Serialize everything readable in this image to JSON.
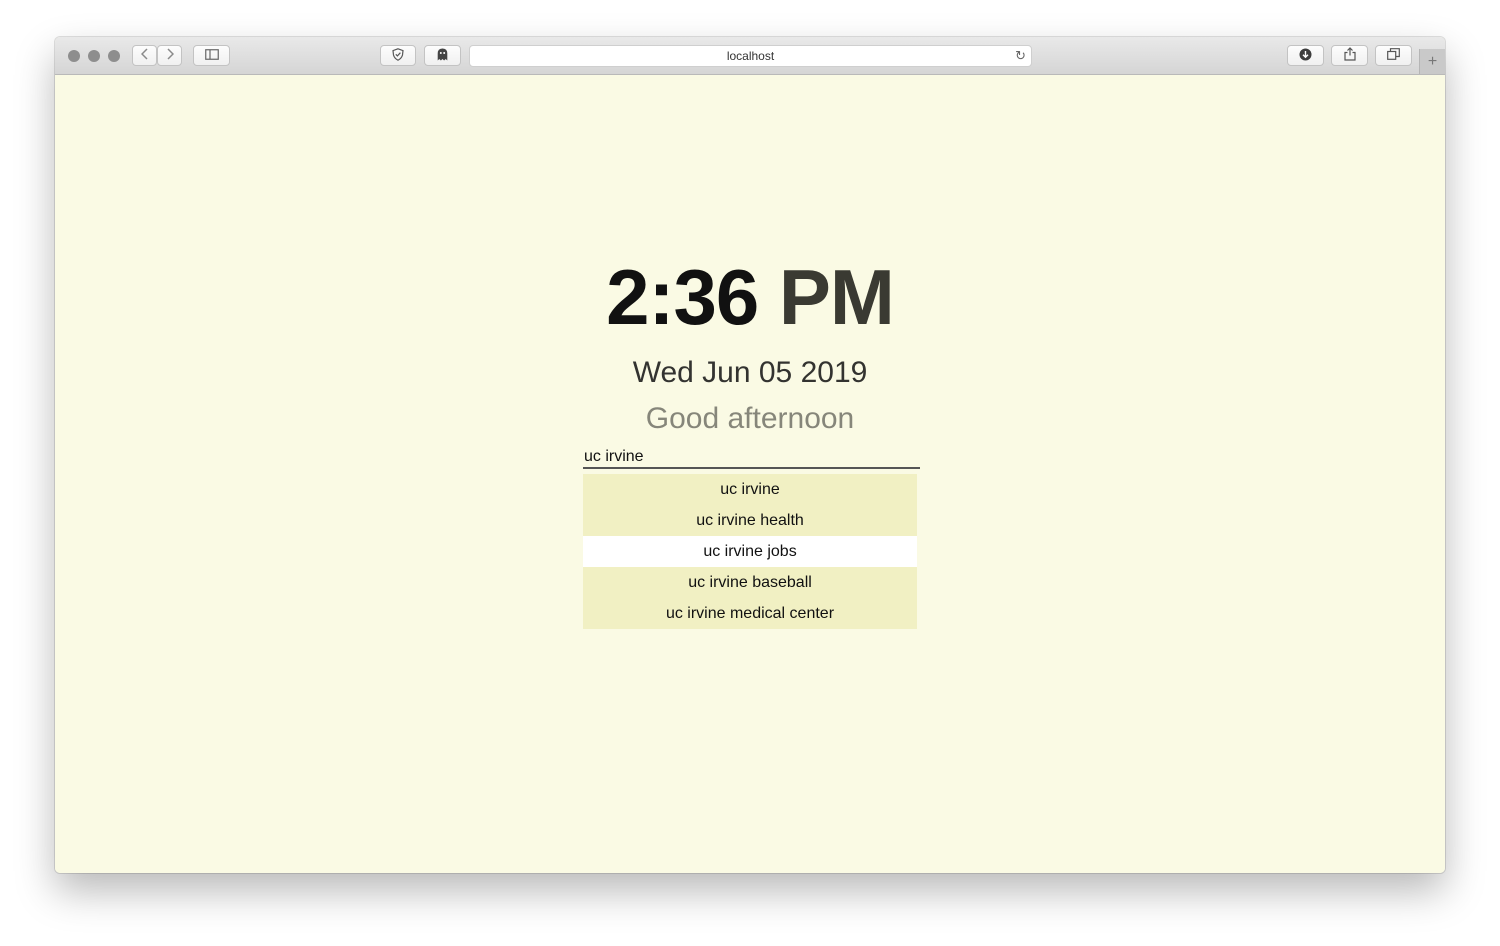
{
  "browser": {
    "url": "localhost",
    "new_tab_symbol": "+",
    "icons": [
      "back-icon",
      "forward-icon",
      "sidebar-icon",
      "shield-icon",
      "ghost-icon",
      "reload-icon",
      "download-icon",
      "share-icon",
      "tabs-icon"
    ]
  },
  "clock": {
    "time": "2:36",
    "ampm": "PM"
  },
  "date": "Wed Jun 05 2019",
  "greeting": "Good afternoon",
  "search": {
    "value": "uc irvine"
  },
  "suggestions": [
    {
      "label": "uc irvine"
    },
    {
      "label": "uc irvine health"
    },
    {
      "label": "uc irvine jobs",
      "highlighted": true
    },
    {
      "label": "uc irvine baseball"
    },
    {
      "label": "uc irvine medical center"
    }
  ]
}
